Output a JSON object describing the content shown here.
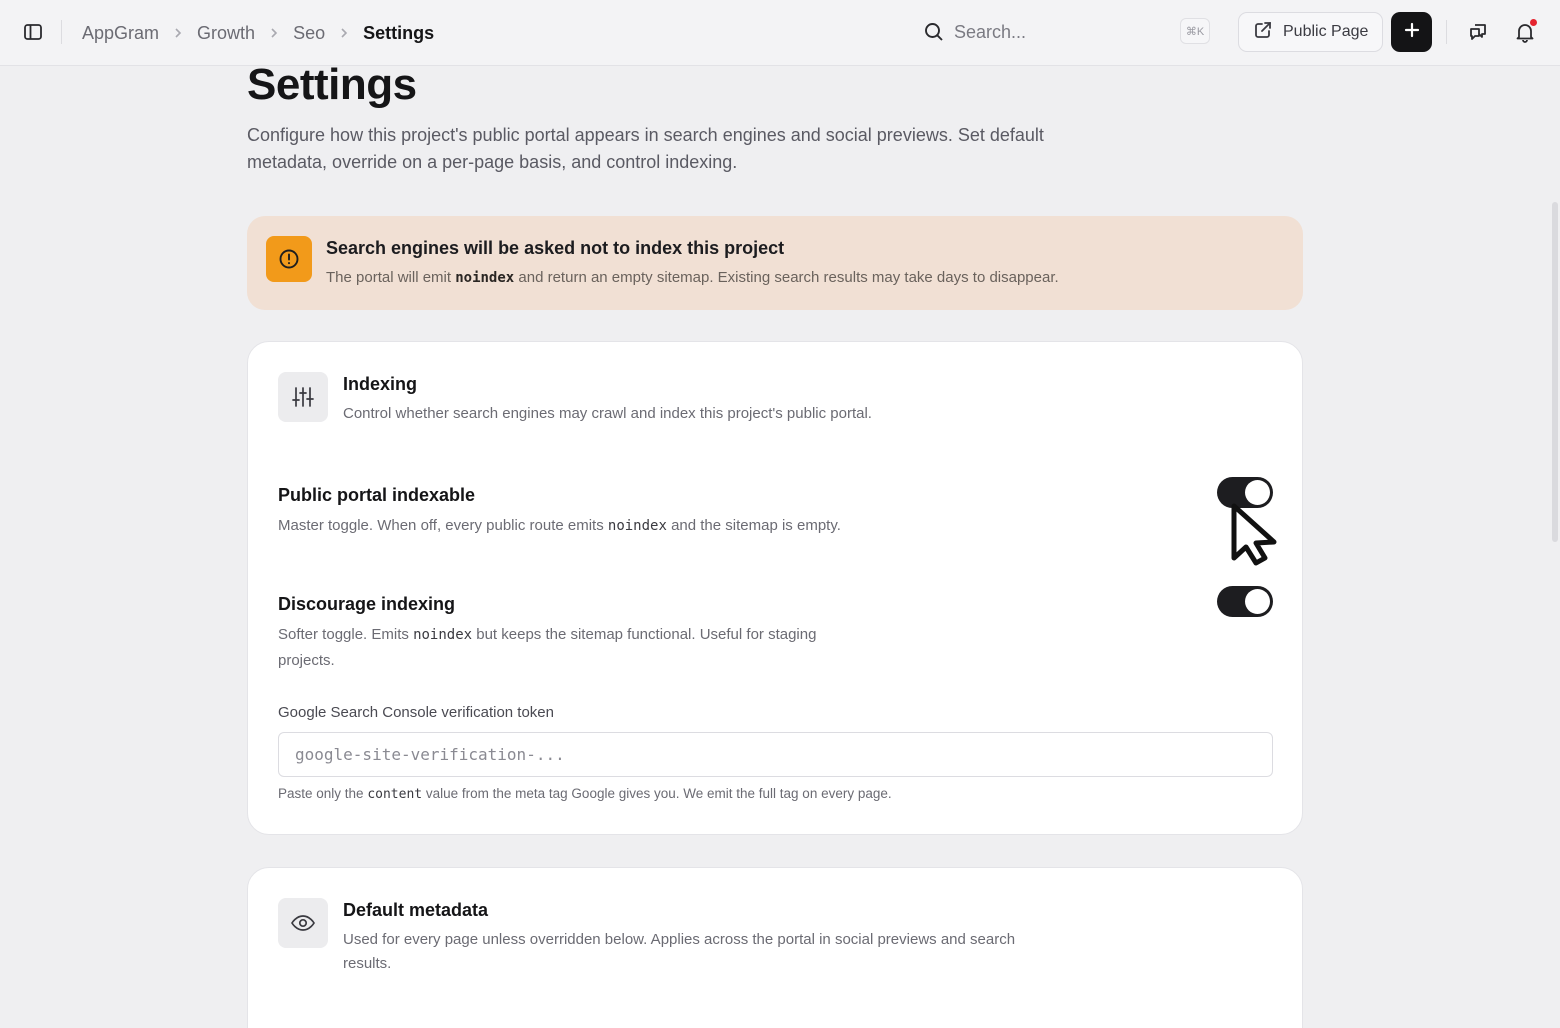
{
  "topbar": {
    "breadcrumb": [
      "AppGram",
      "Growth",
      "Seo",
      "Settings"
    ],
    "search_placeholder": "Search...",
    "search_shortcut": "⌘K",
    "public_page_label": "Public Page",
    "add_label": "+"
  },
  "page": {
    "title": "Settings",
    "description": "Configure how this project's public portal appears in search engines and social previews. Set default metadata, override on a per-page basis, and control indexing."
  },
  "alert": {
    "title": "Search engines will be asked not to index this project",
    "desc_before": "The portal will emit ",
    "desc_code": "noindex",
    "desc_after": " and return an empty sitemap. Existing search results may take days to disappear.",
    "color": "#f29a1a"
  },
  "indexing_card": {
    "title": "Indexing",
    "description": "Control whether search engines may crawl and index this project's public portal.",
    "settings": [
      {
        "title": "Public portal indexable",
        "desc_before": "Master toggle. When off, every public route emits ",
        "desc_code": "noindex",
        "desc_after": " and the sitemap is empty.",
        "enabled": true
      },
      {
        "title": "Discourage indexing",
        "desc_before": "Softer toggle. Emits ",
        "desc_code": "noindex",
        "desc_after": " but keeps the sitemap functional. Useful for staging projects.",
        "enabled": true
      }
    ],
    "token": {
      "label": "Google Search Console verification token",
      "placeholder": "google-site-verification-...",
      "value": "",
      "help_before": "Paste only the ",
      "help_code": "content",
      "help_after": " value from the meta tag Google gives you. We emit the full tag on every page."
    }
  },
  "metadata_card": {
    "title": "Default metadata",
    "description": "Used for every page unless overridden below. Applies across the portal in social previews and search results."
  }
}
